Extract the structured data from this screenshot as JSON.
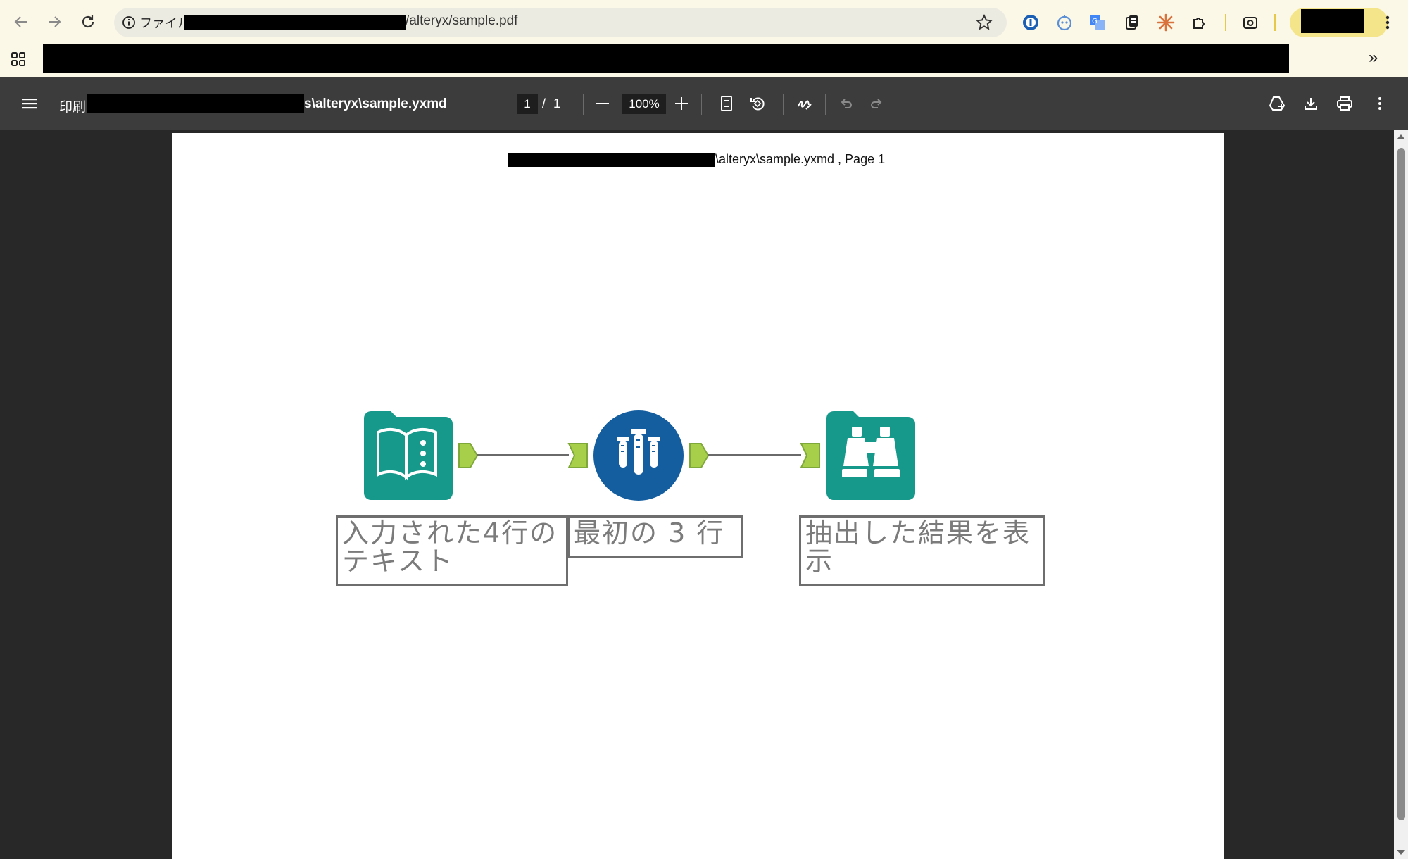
{
  "browser": {
    "omnibox": {
      "scheme_label": "ファイル",
      "url_suffix": "/alteryx/sample.pdf"
    },
    "icons": [
      "back-icon",
      "forward-icon",
      "reload-icon",
      "info-icon",
      "star-icon",
      "password-icon",
      "extension-icon",
      "translate-icon",
      "clipboard-icon",
      "sun-icon",
      "puzzle-icon",
      "screenshot-icon",
      "menu-dots-icon"
    ],
    "bookmarks_overflow": "»"
  },
  "pdf_toolbar": {
    "print_label": "印刷",
    "title_suffix": "s\\alteryx\\sample.yxmd",
    "page_current": "1",
    "page_separator": "/",
    "page_total": "1",
    "zoom": "100%"
  },
  "page": {
    "header_suffix": "\\alteryx\\sample.yxmd , Page 1"
  },
  "workflow": {
    "tools": [
      {
        "name": "input",
        "label": "入力された4行のテキスト",
        "color": "#16998a"
      },
      {
        "name": "sample",
        "label": "最初の 3 行",
        "color": "#145ea0"
      },
      {
        "name": "browse",
        "label": "抽出した結果を表示",
        "color": "#16998a"
      }
    ],
    "anchor_color": "#a8cf4a"
  }
}
